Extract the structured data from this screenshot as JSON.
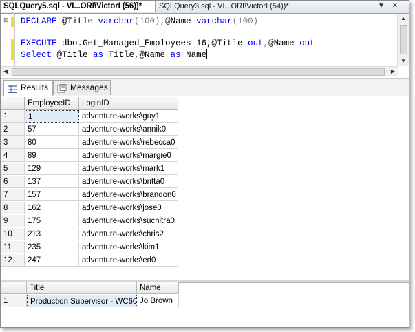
{
  "tabs": [
    {
      "label": "SQLQuery5.sql - VI...ORI\\VictorI (56))*"
    },
    {
      "label": "SQLQuery3.sql - VI...ORI\\VictorI (54))*"
    }
  ],
  "editor": {
    "line1": {
      "kw1": "DECLARE",
      "p1": " @Title ",
      "kw2": "varchar",
      "g1": "(100),",
      "p2": "@Name ",
      "kw3": "varchar",
      "g2": "(100)"
    },
    "line3": {
      "kw1": "EXECUTE",
      "p1": " dbo.Get_Managed_Employees 16,@Title ",
      "kw2": "out",
      "g1": ",",
      "p2": "@Name ",
      "kw3": "out"
    },
    "line4": {
      "kw1": "Select",
      "p1": " @Title ",
      "kw2": "as",
      "p2": " Title,@Name ",
      "kw3": "as",
      "p3": " Name"
    }
  },
  "result_tabs": [
    {
      "label": "Results"
    },
    {
      "label": "Messages"
    }
  ],
  "grid1": {
    "columns": [
      "EmployeeID",
      "LoginID"
    ],
    "rows": [
      {
        "n": "1",
        "id": "1",
        "login": "adventure-works\\guy1"
      },
      {
        "n": "2",
        "id": "57",
        "login": "adventure-works\\annik0"
      },
      {
        "n": "3",
        "id": "80",
        "login": "adventure-works\\rebecca0"
      },
      {
        "n": "4",
        "id": "89",
        "login": "adventure-works\\margie0"
      },
      {
        "n": "5",
        "id": "129",
        "login": "adventure-works\\mark1"
      },
      {
        "n": "6",
        "id": "137",
        "login": "adventure-works\\britta0"
      },
      {
        "n": "7",
        "id": "157",
        "login": "adventure-works\\brandon0"
      },
      {
        "n": "8",
        "id": "162",
        "login": "adventure-works\\jose0"
      },
      {
        "n": "9",
        "id": "175",
        "login": "adventure-works\\suchitra0"
      },
      {
        "n": "10",
        "id": "213",
        "login": "adventure-works\\chris2"
      },
      {
        "n": "11",
        "id": "235",
        "login": "adventure-works\\kim1"
      },
      {
        "n": "12",
        "id": "247",
        "login": "adventure-works\\ed0"
      }
    ]
  },
  "grid2": {
    "columns": [
      "Title",
      "Name"
    ],
    "rows": [
      {
        "n": "1",
        "title": "Production Supervisor - WC60",
        "name": "Jo Brown"
      }
    ]
  },
  "colors": {
    "keyword": "#0000ff",
    "punct": "#808080",
    "tab_border": "#8fa1bc"
  }
}
